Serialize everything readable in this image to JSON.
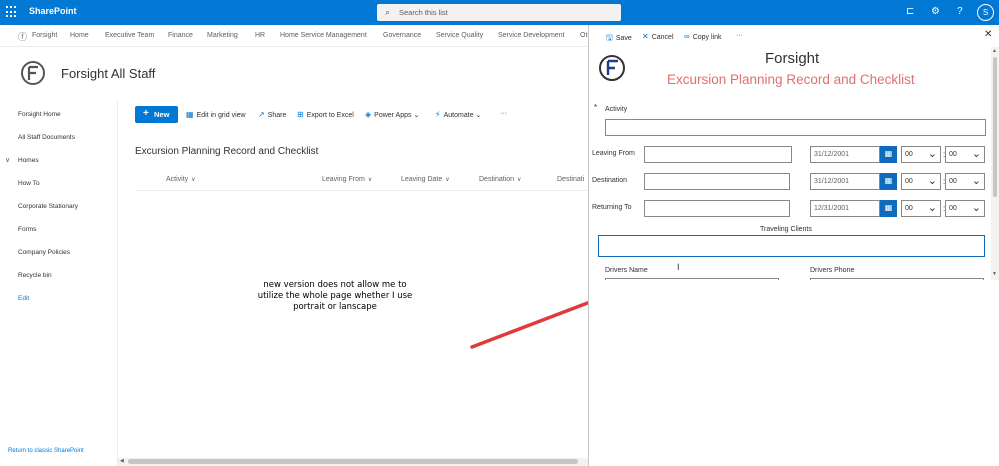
{
  "suite": {
    "brand": "SharePoint",
    "search_placeholder": "Search this list",
    "avatar_initial": "S"
  },
  "hubnav": {
    "items": [
      "Forsight",
      "Home",
      "Executive Team",
      "Finance",
      "Marketing",
      "HR",
      "Home Service Management",
      "Governance",
      "Service Quality",
      "Service Development",
      "Ot"
    ]
  },
  "site": {
    "title": "Forsight All Staff"
  },
  "leftnav": {
    "items": [
      "Forsight Home",
      "All Staff Documents",
      "Homes",
      "How To",
      "Corporate Stationary",
      "Forms",
      "Company Policies",
      "Recycle bin",
      "Edit"
    ],
    "classic_link": "Return to classic SharePoint"
  },
  "cmdbar": {
    "new": "New",
    "edit_grid": "Edit in grid view",
    "share": "Share",
    "export": "Export to Excel",
    "power_apps": "Power Apps",
    "automate": "Automate"
  },
  "list": {
    "title": "Excursion Planning Record and Checklist",
    "columns": [
      "Activity",
      "Leaving From",
      "Leaving Date",
      "Destination",
      "Destinati"
    ]
  },
  "annotation": {
    "note": "new version does not allow me to utilize the whole page whether I use portrait or lanscape"
  },
  "panel": {
    "toolbar": {
      "save": "Save",
      "cancel": "Cancel",
      "copy_link": "Copy link"
    },
    "form": {
      "header1": "Forsight",
      "header2": "Excursion Planning Record and Checklist",
      "activity_label": "Activity",
      "required_mark": "*",
      "rows": [
        {
          "label": "Leaving From",
          "date": "31/12/2001",
          "hour": "00",
          "minute": "00"
        },
        {
          "label": "Destination",
          "date": "31/12/2001",
          "hour": "00",
          "minute": "00"
        },
        {
          "label": "Returning To",
          "date": "12/31/2001",
          "hour": "00",
          "minute": "00"
        }
      ],
      "time_separator": ":",
      "traveling_clients_label": "Traveling Clients",
      "drivers_name_label": "Drivers Name",
      "drivers_phone_label": "Drivers Phone"
    }
  },
  "colors": {
    "suite": "#0078d4",
    "accent": "#0078d4",
    "form_header": "#e07070",
    "annotation_arrow": "#e03a3a"
  }
}
